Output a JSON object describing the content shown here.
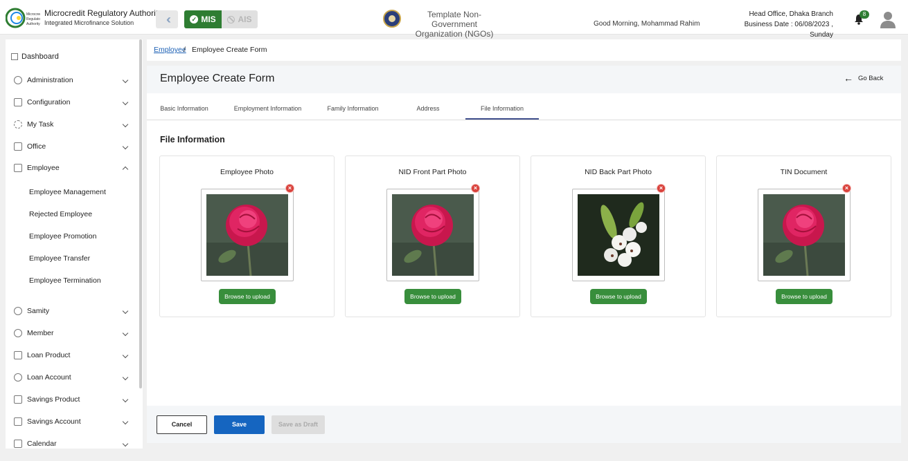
{
  "header": {
    "brand_title": "Microcredit Regulatory Authority",
    "brand_subtitle": "Integrated Microfinance Solution",
    "logo_text": "Microcredit Regulatory Authority",
    "module_mis": "MIS",
    "module_ais": "AIS",
    "org_name_line1": "Template Non-Government",
    "org_name_line2": "Organization (NGOs)",
    "greeting": "Good Morning, Mohammad Rahim",
    "branch": "Head Office, Dhaka Branch",
    "business_date": "Business Date : 06/08/2023 , Sunday",
    "notification_count": "8",
    "accent": "#2e7d32"
  },
  "sidebar": {
    "dashboard": "Dashboard",
    "items": [
      {
        "label": "Administration"
      },
      {
        "label": "Configuration"
      },
      {
        "label": "My Task"
      },
      {
        "label": "Office"
      },
      {
        "label": "Employee"
      }
    ],
    "employee_sub": [
      "Employee Management",
      "Rejected Employee",
      "Employee Promotion",
      "Employee Transfer",
      "Employee Termination"
    ],
    "items_after": [
      {
        "label": "Samity"
      },
      {
        "label": "Member"
      },
      {
        "label": "Loan Product"
      },
      {
        "label": "Loan Account"
      },
      {
        "label": "Savings Product"
      },
      {
        "label": "Savings Account"
      },
      {
        "label": "Calendar"
      }
    ]
  },
  "breadcrumb": {
    "link": "Employee",
    "separator": "/",
    "current": "Employee Create Form"
  },
  "page": {
    "title": "Employee Create Form",
    "go_back": "Go Back",
    "tabs": [
      {
        "label": "Basic Information"
      },
      {
        "label": "Employment Information"
      },
      {
        "label": "Family Information"
      },
      {
        "label": "Address"
      },
      {
        "label": "File Information",
        "active": true
      }
    ],
    "section_title": "File Information",
    "cards": [
      {
        "label": "Employee Photo",
        "image": "rose",
        "button": "Browse to upload"
      },
      {
        "label": "NID Front Part Photo",
        "image": "rose",
        "button": "Browse to upload"
      },
      {
        "label": "NID Back Part Photo",
        "image": "white-flowers",
        "button": "Browse to upload"
      },
      {
        "label": "TIN Document",
        "image": "rose",
        "button": "Browse to upload"
      }
    ]
  },
  "footer": {
    "cancel": "Cancel",
    "save": "Save",
    "save_draft": "Save as Draft"
  }
}
